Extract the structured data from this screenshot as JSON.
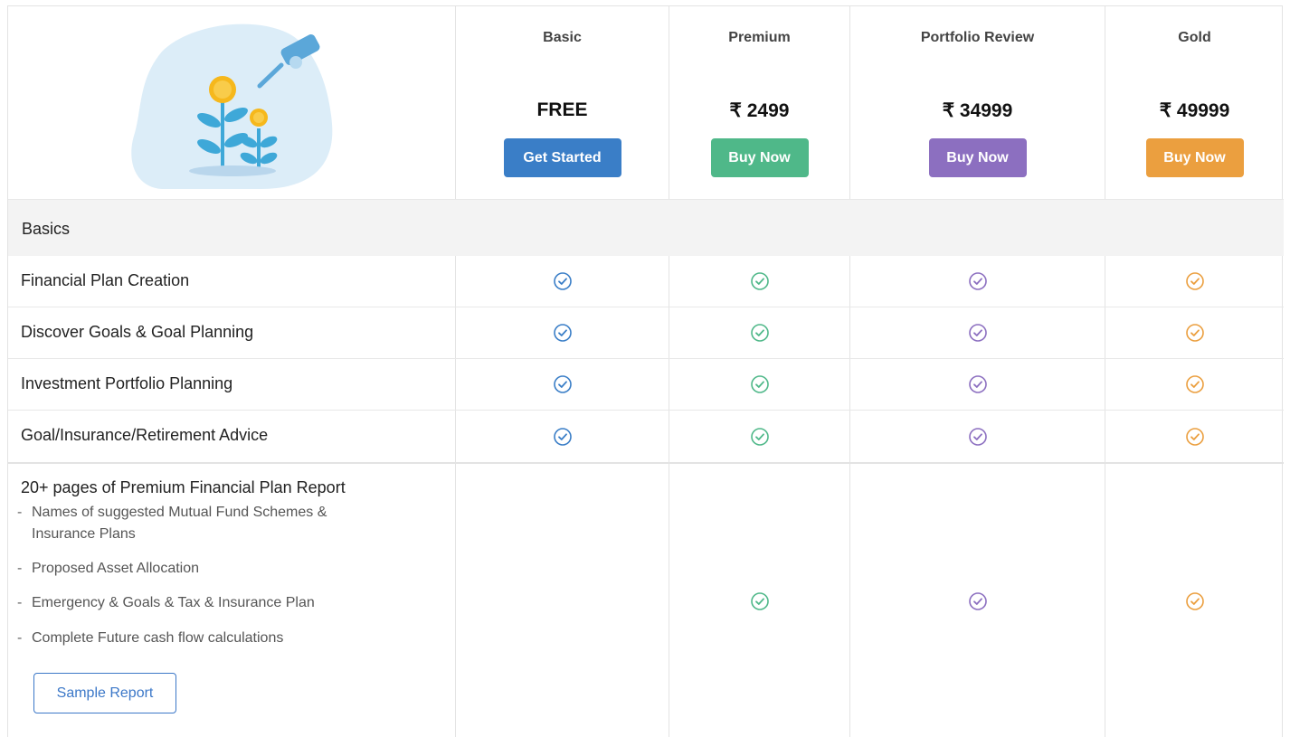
{
  "plans": [
    {
      "name": "Basic",
      "price": "FREE",
      "button": "Get Started",
      "color": "#3a7ec7"
    },
    {
      "name": "Premium",
      "price": "₹ 2499",
      "button": "Buy Now",
      "color": "#4fb889"
    },
    {
      "name": "Portfolio Review",
      "price": "₹ 34999",
      "button": "Buy Now",
      "color": "#8c6fc0"
    },
    {
      "name": "Gold",
      "price": "₹ 49999",
      "button": "Buy Now",
      "color": "#eb9f3f"
    }
  ],
  "section": {
    "label": "Basics"
  },
  "features": [
    {
      "label": "Financial Plan Creation",
      "included": [
        true,
        true,
        true,
        true
      ]
    },
    {
      "label": "Discover Goals & Goal Planning",
      "included": [
        true,
        true,
        true,
        true
      ]
    },
    {
      "label": "Investment Portfolio Planning",
      "included": [
        true,
        true,
        true,
        true
      ]
    },
    {
      "label": "Goal/Insurance/Retirement Advice",
      "included": [
        true,
        true,
        true,
        true
      ]
    }
  ],
  "report": {
    "title": "20+ pages of Premium Financial Plan Report",
    "items": [
      "Names of suggested Mutual Fund Schemes & Insurance Plans",
      "Proposed Asset Allocation",
      "Emergency & Goals & Tax & Insurance Plan",
      "Complete Future cash flow calculations"
    ],
    "button": "Sample Report",
    "included": [
      false,
      true,
      true,
      true
    ]
  },
  "illustration": {
    "icon": "money-plant-watering-can-icon"
  }
}
